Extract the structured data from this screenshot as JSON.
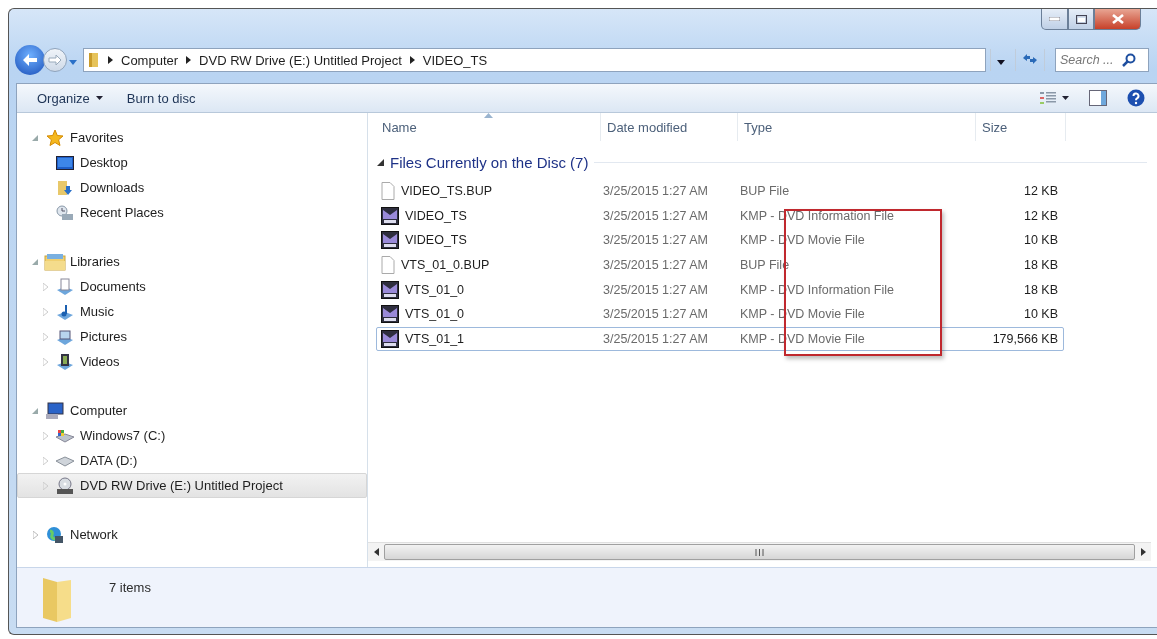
{
  "address_bar": {
    "breadcrumbs": [
      "Computer",
      "DVD RW Drive (E:) Untitled Project",
      "VIDEO_TS"
    ]
  },
  "search": {
    "placeholder": "Search ..."
  },
  "toolbar": {
    "buttons": [
      {
        "label": "Organize",
        "kind": "menu"
      },
      {
        "label": "Burn to disc",
        "kind": "plain"
      }
    ]
  },
  "sidebar": {
    "groups": [
      {
        "label": "Favorites",
        "expanded": true,
        "selected": false,
        "children": [
          {
            "label": "Desktop",
            "expandable": false,
            "selected": false
          },
          {
            "label": "Downloads",
            "expandable": false,
            "selected": false
          },
          {
            "label": "Recent Places",
            "expandable": false,
            "selected": false
          }
        ]
      },
      {
        "label": "Libraries",
        "expanded": true,
        "selected": false,
        "children": [
          {
            "label": "Documents",
            "expandable": true,
            "selected": false
          },
          {
            "label": "Music",
            "expandable": true,
            "selected": false
          },
          {
            "label": "Pictures",
            "expandable": true,
            "selected": false
          },
          {
            "label": "Videos",
            "expandable": true,
            "selected": false
          }
        ]
      },
      {
        "label": "Computer",
        "expanded": true,
        "selected": false,
        "children": [
          {
            "label": "Windows7 (C:)",
            "expandable": true,
            "selected": false
          },
          {
            "label": "DATA (D:)",
            "expandable": true,
            "selected": false
          },
          {
            "label": "DVD RW Drive (E:) Untitled Project",
            "expandable": true,
            "selected": true
          }
        ]
      },
      {
        "label": "Network",
        "expanded": false,
        "selected": false
      }
    ]
  },
  "table": {
    "columns": [
      {
        "label": "Name",
        "sorted": true
      },
      {
        "label": "Date modified",
        "sorted": false
      },
      {
        "label": "Type",
        "sorted": false
      },
      {
        "label": "Size",
        "sorted": false
      }
    ],
    "group": {
      "label": "Files Currently on the Disc (7)",
      "expanded": true
    },
    "rows": [
      {
        "name": "VIDEO_TS.BUP",
        "kind": "blank",
        "date": "3/25/2015 1:27 AM",
        "type": "BUP File",
        "size": "12 KB",
        "selected": false
      },
      {
        "name": "VIDEO_TS",
        "kind": "media",
        "date": "3/25/2015 1:27 AM",
        "type": "KMP - DVD Information File",
        "size": "12 KB",
        "selected": false
      },
      {
        "name": "VIDEO_TS",
        "kind": "media",
        "date": "3/25/2015 1:27 AM",
        "type": "KMP - DVD Movie File",
        "size": "10 KB",
        "selected": false
      },
      {
        "name": "VTS_01_0.BUP",
        "kind": "blank",
        "date": "3/25/2015 1:27 AM",
        "type": "BUP File",
        "size": "18 KB",
        "selected": false
      },
      {
        "name": "VTS_01_0",
        "kind": "media",
        "date": "3/25/2015 1:27 AM",
        "type": "KMP - DVD Information File",
        "size": "18 KB",
        "selected": false
      },
      {
        "name": "VTS_01_0",
        "kind": "media",
        "date": "3/25/2015 1:27 AM",
        "type": "KMP - DVD Movie File",
        "size": "10 KB",
        "selected": false
      },
      {
        "name": "VTS_01_1",
        "kind": "media",
        "date": "3/25/2015 1:27 AM",
        "type": "KMP - DVD Movie File",
        "size": "179,566 KB",
        "selected": true
      }
    ]
  },
  "status_bar": {
    "text": "7 items"
  }
}
